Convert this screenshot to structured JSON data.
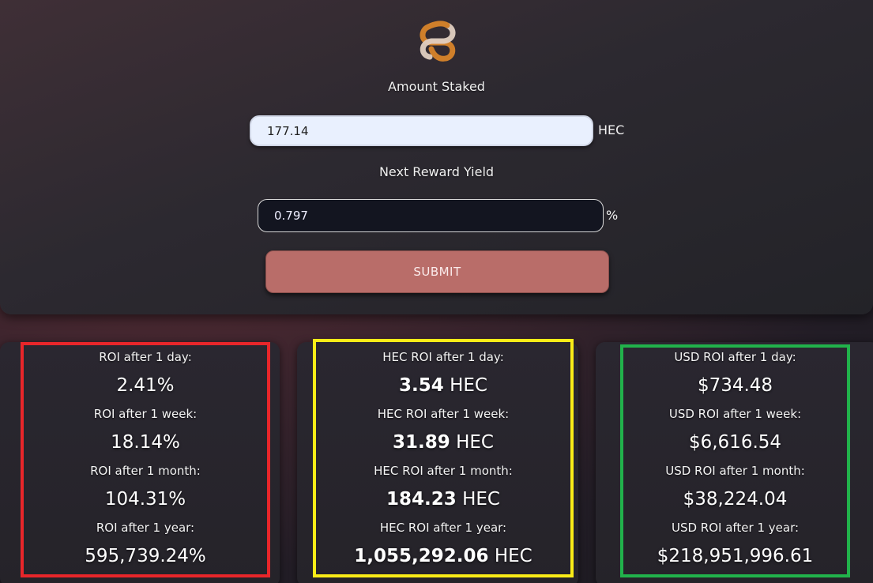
{
  "form": {
    "amount_label": "Amount Staked",
    "amount_value": "177.14",
    "amount_unit": "HEC",
    "yield_label": "Next Reward Yield",
    "yield_value": "0.797",
    "yield_unit": "%",
    "submit_label": "SUBMIT"
  },
  "roi_percent": {
    "frame_color": "#e8262a",
    "rows": [
      {
        "label": "ROI after 1 day:",
        "value": "2.41%"
      },
      {
        "label": "ROI after 1 week:",
        "value": "18.14%"
      },
      {
        "label": "ROI after 1 month:",
        "value": "104.31%"
      },
      {
        "label": "ROI after 1 year:",
        "value": "595,739.24%"
      }
    ]
  },
  "roi_hec": {
    "frame_color": "#f9ec17",
    "unit": "HEC",
    "rows": [
      {
        "label": "HEC ROI after 1 day:",
        "value": "3.54"
      },
      {
        "label": "HEC ROI after 1 week:",
        "value": "31.89"
      },
      {
        "label": "HEC ROI after 1 month:",
        "value": "184.23"
      },
      {
        "label": "HEC ROI after 1 year:",
        "value": "1,055,292.06"
      }
    ]
  },
  "roi_usd": {
    "frame_color": "#21b24b",
    "rows": [
      {
        "label": "USD ROI after 1 day:",
        "value": "$734.48"
      },
      {
        "label": "USD ROI after 1 week:",
        "value": "$6,616.54"
      },
      {
        "label": "USD ROI after 1 month:",
        "value": "$38,224.04"
      },
      {
        "label": "USD ROI after 1 year:",
        "value": "$218,951,996.61"
      }
    ]
  },
  "icons": {
    "logo": "hector-logo-icon"
  },
  "colors": {
    "submit_bg": "#b96d69",
    "amount_input_bg": "#e9f0fe",
    "yield_input_bg": "#131520"
  }
}
